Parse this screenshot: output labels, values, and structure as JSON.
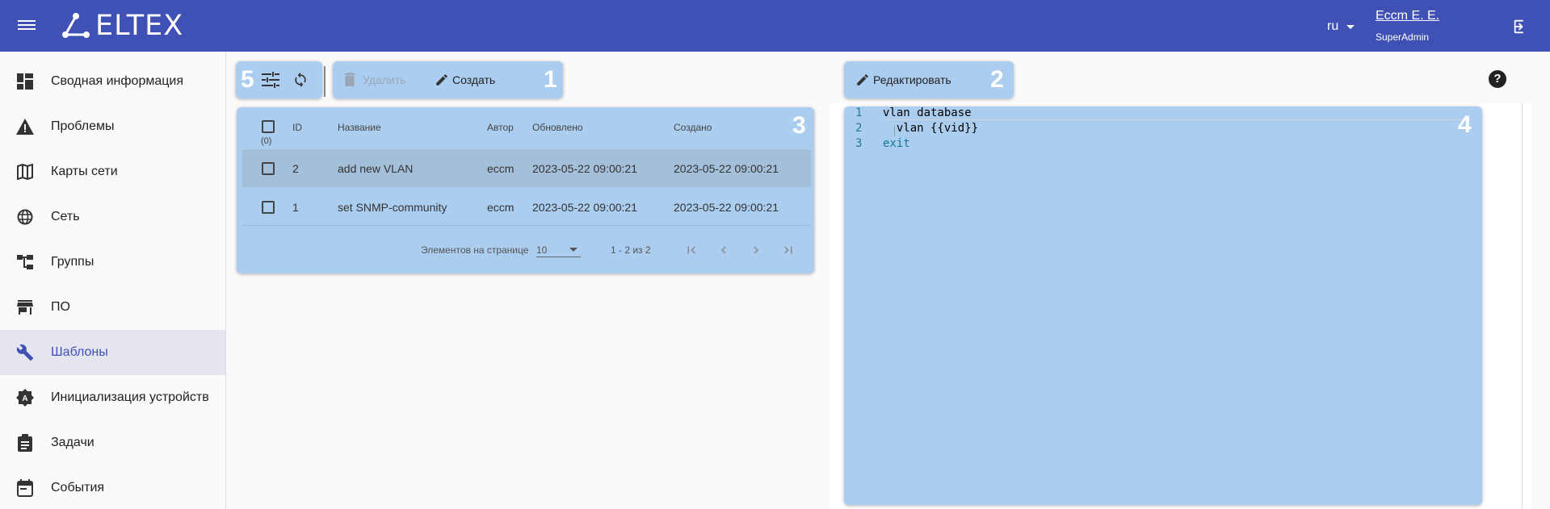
{
  "header": {
    "logo_text": "ELTEX",
    "language": "ru",
    "user_name": "Eccm E. E.",
    "user_role": "SuperAdmin"
  },
  "sidebar": {
    "items": [
      {
        "label": "Сводная информация",
        "icon": "dashboard-icon"
      },
      {
        "label": "Проблемы",
        "icon": "warning-icon"
      },
      {
        "label": "Карты сети",
        "icon": "map-icon"
      },
      {
        "label": "Сеть",
        "icon": "globe-icon"
      },
      {
        "label": "Группы",
        "icon": "tree-icon"
      },
      {
        "label": "ПО",
        "icon": "store-icon"
      },
      {
        "label": "Шаблоны",
        "icon": "wrench-icon",
        "active": true
      },
      {
        "label": "Инициализация устройств",
        "icon": "badge-a-icon"
      },
      {
        "label": "Задачи",
        "icon": "clipboard-icon"
      },
      {
        "label": "События",
        "icon": "calendar-icon"
      }
    ]
  },
  "toolbar": {
    "delete_label": "Удалить",
    "create_label": "Создать",
    "edit_label": "Редактировать"
  },
  "markers": {
    "m1": "1",
    "m2": "2",
    "m3": "3",
    "m4": "4",
    "m5": "5"
  },
  "table": {
    "select_count": "(0)",
    "columns": [
      "ID",
      "Название",
      "Автор",
      "Обновлено",
      "Создано"
    ],
    "rows": [
      {
        "id": "2",
        "name": "add new VLAN",
        "author": "eccm",
        "updated": "2023-05-22 09:00:21",
        "created": "2023-05-22 09:00:21"
      },
      {
        "id": "1",
        "name": "set SNMP-community",
        "author": "eccm",
        "updated": "2023-05-22 09:00:21",
        "created": "2023-05-22 09:00:21"
      }
    ],
    "pager": {
      "per_page_label": "Элементов на странице",
      "per_page_value": "10",
      "range": "1 - 2 из 2"
    }
  },
  "editor": {
    "lines": [
      {
        "num": "1",
        "text": "vlan database"
      },
      {
        "num": "2",
        "text": "  vlan {{vid}}"
      },
      {
        "num": "3",
        "text": "exit"
      }
    ]
  },
  "colors": {
    "header_bg": "#3f51b5",
    "highlight": "#abcdef",
    "accent": "#3f51b5"
  }
}
